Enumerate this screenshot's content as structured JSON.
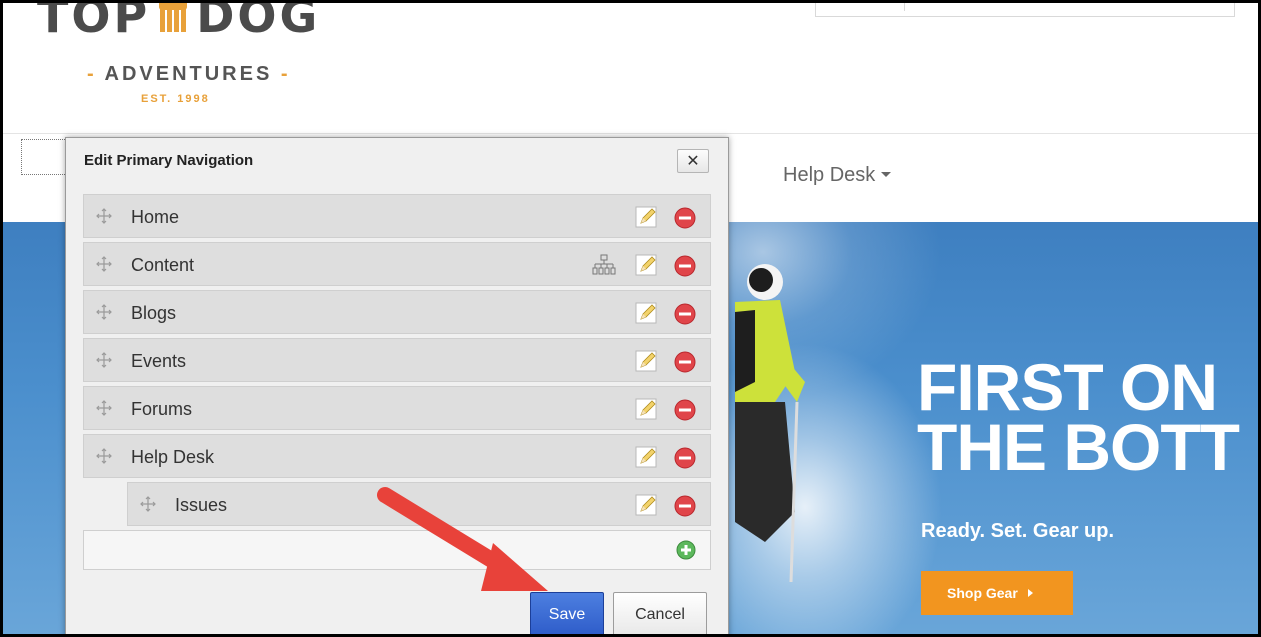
{
  "header": {
    "logo": {
      "main_text_left": "TOP",
      "main_text_right": "DOG",
      "sub_text": "ADVENTURES",
      "est_text": "EST. 1998",
      "accent_color": "#e8a13a"
    }
  },
  "navbar": {
    "help_desk_label": "Help Desk"
  },
  "hero": {
    "title_line1": "FIRST ON",
    "title_line2": "THE BOTT",
    "subtitle": "Ready. Set. Gear up.",
    "shop_button_label": "Shop Gear"
  },
  "dialog": {
    "title": "Edit Primary Navigation",
    "close_label": "✕",
    "items": [
      {
        "label": "Home",
        "has_sitemap": false,
        "level": 0
      },
      {
        "label": "Content",
        "has_sitemap": true,
        "level": 0
      },
      {
        "label": "Blogs",
        "has_sitemap": false,
        "level": 0
      },
      {
        "label": "Events",
        "has_sitemap": false,
        "level": 0
      },
      {
        "label": "Forums",
        "has_sitemap": false,
        "level": 0
      },
      {
        "label": "Help Desk",
        "has_sitemap": false,
        "level": 0
      },
      {
        "label": "Issues",
        "has_sitemap": false,
        "level": 1
      }
    ],
    "save_label": "Save",
    "cancel_label": "Cancel"
  },
  "colors": {
    "save_button": "#2e5cc9",
    "remove_icon": "#e0454a",
    "add_icon": "#5cb85c",
    "annotation_arrow": "#e8423a",
    "hero_blue": "#4b8fcd",
    "shop_button": "#f2951f"
  }
}
